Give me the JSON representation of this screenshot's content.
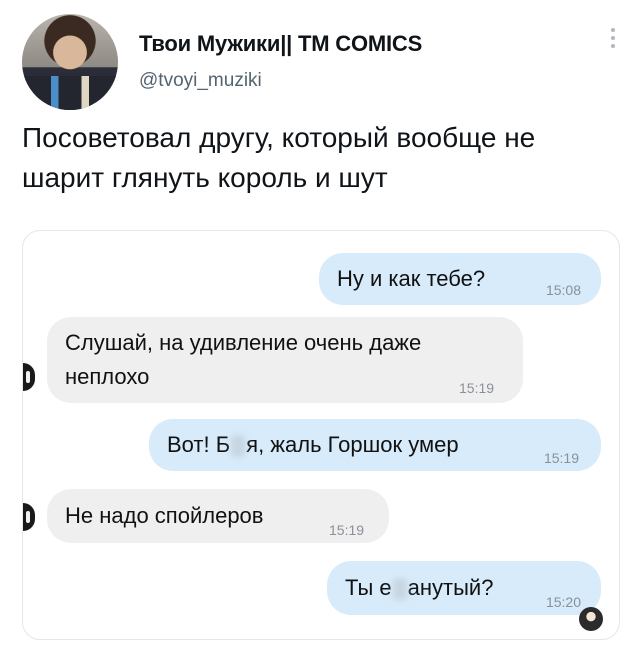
{
  "tweet": {
    "author_name": "Твои Мужики|| ТМ COMICS",
    "handle": "@tvoyi_muziki",
    "text": "Посоветовал другу, который вообще не шарит глянуть король и шут"
  },
  "chat": {
    "messages": [
      {
        "side": "out",
        "text": "Ну и как тебе?",
        "time": "15:08"
      },
      {
        "side": "in",
        "line1": "Слушай, на удивление очень даже",
        "line2": "неплохо",
        "time": "15:19"
      },
      {
        "side": "out",
        "pre": "Вот! Б",
        "post": "я, жаль Горшок умер",
        "time": "15:19"
      },
      {
        "side": "in",
        "text": "Не надо спойлеров",
        "time": "15:19"
      },
      {
        "side": "out",
        "pre": "Ты е",
        "post": "анутый?",
        "time": "15:20"
      }
    ]
  }
}
